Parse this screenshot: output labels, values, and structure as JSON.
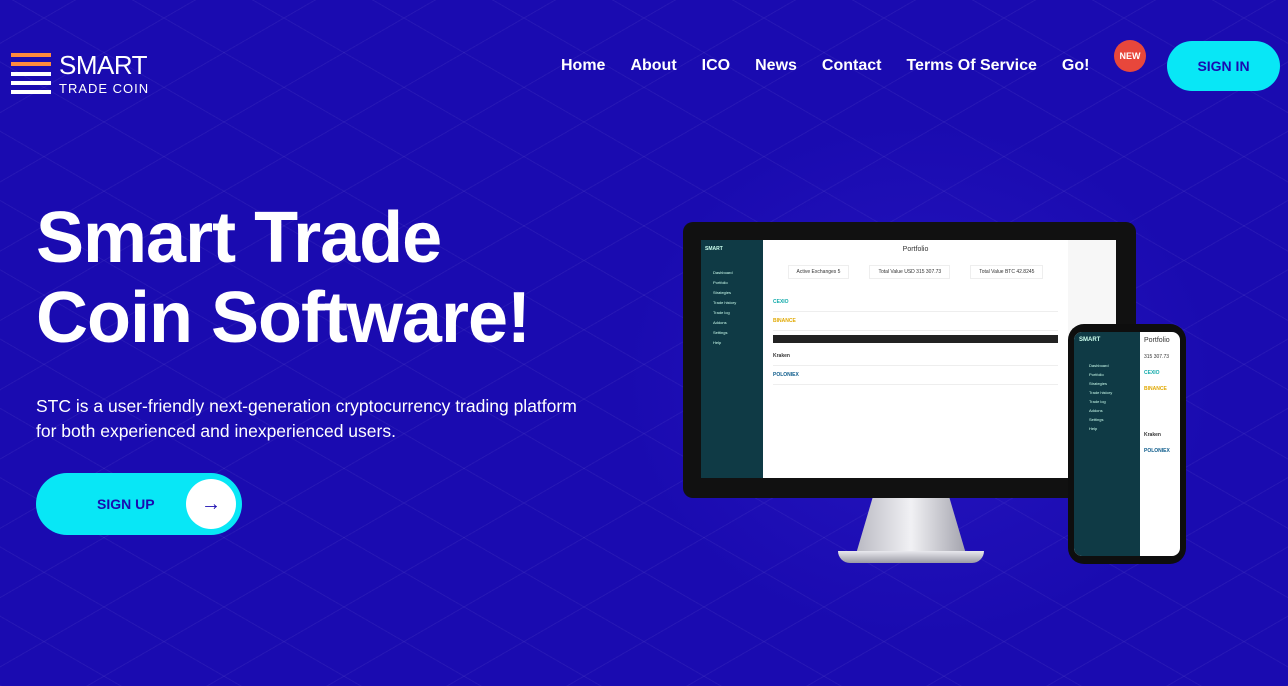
{
  "brand": {
    "name_line1": "SMART",
    "name_line2": "TRADE COIN"
  },
  "nav": {
    "items": [
      "Home",
      "About",
      "ICO",
      "News",
      "Contact",
      "Terms Of Service",
      "Go!"
    ],
    "new_badge": "NEW",
    "signin": "SIGN IN"
  },
  "hero": {
    "title_line1": "Smart Trade",
    "title_line2": "Coin Software!",
    "subtitle_line1": "STC is a user-friendly next-generation cryptocurrency trading platform",
    "subtitle_line2": "for both experienced and inexperienced users.",
    "signup": "SIGN UP",
    "signup_icon": "arrow-right-icon"
  },
  "monitor": {
    "app_brand": "SMART",
    "page_title": "Portfolio",
    "menu": [
      "Dashboard",
      "Portfolio",
      "Strategies",
      "Trade history",
      "Trade log",
      "Addons",
      "Settings",
      "Help"
    ],
    "stats": [
      "Active Exchanges 5",
      "Total Value USD 315 307.73",
      "Total Value BTC 42.8245"
    ],
    "exchanges": [
      "CEXIO",
      "BINANCE",
      "Kraken",
      "POLONIEX"
    ]
  },
  "phone": {
    "app_brand": "SMART",
    "page_title": "Portfolio",
    "total_usd": "315 307.73",
    "menu": [
      "Dashboard",
      "Portfolio",
      "Strategies",
      "Trade history",
      "Trade log",
      "Addons",
      "Settings",
      "Help"
    ],
    "exchanges": [
      "CEXIO",
      "BINANCE",
      "Kraken",
      "POLONIEX"
    ]
  },
  "colors": {
    "background": "#1a0bb0",
    "accent": "#08e7f6",
    "badge": "#e8473b",
    "logo_orange": "#ff8a3d"
  }
}
